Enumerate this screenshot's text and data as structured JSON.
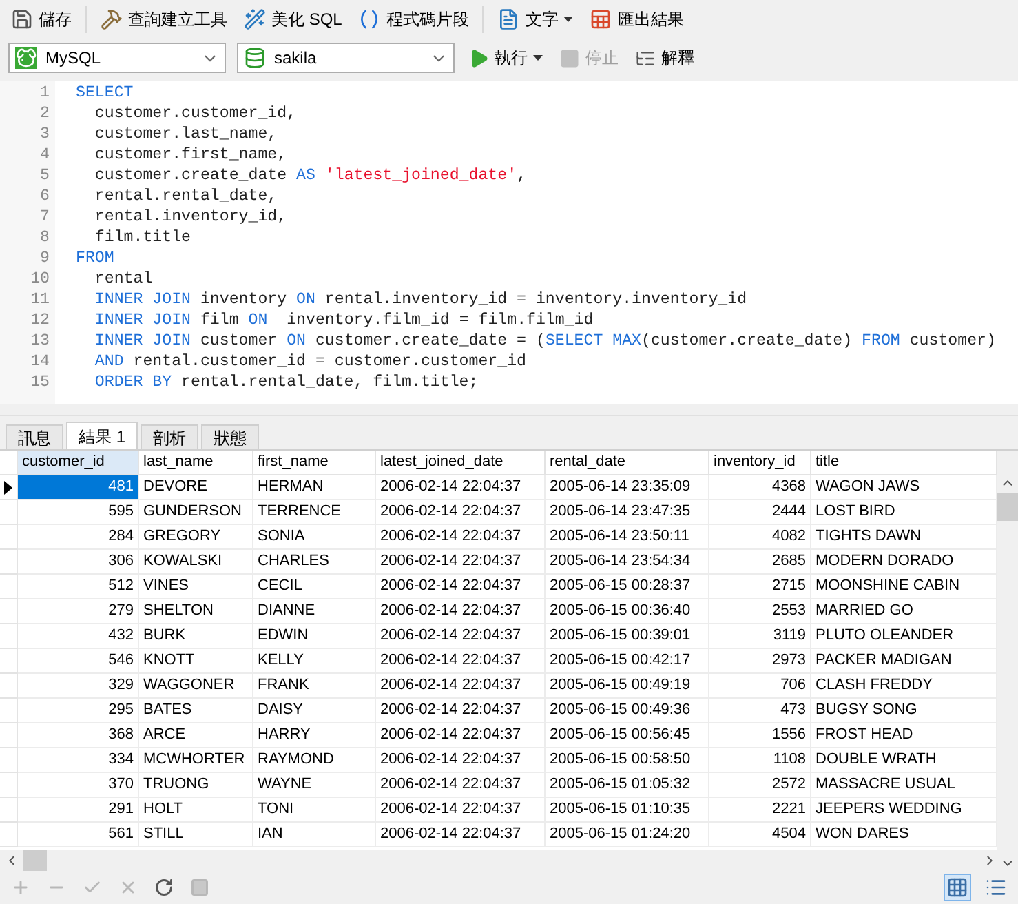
{
  "toolbar": [
    {
      "kind": "save",
      "label": "儲存"
    },
    {
      "kind": "builder",
      "label": "查詢建立工具"
    },
    {
      "kind": "beautify",
      "label": "美化 SQL"
    },
    {
      "kind": "snippet",
      "label": "程式碼片段"
    },
    {
      "kind": "text",
      "label": "文字",
      "dropdown": true
    },
    {
      "kind": "export",
      "label": "匯出結果"
    }
  ],
  "connection": {
    "value": "MySQL"
  },
  "database": {
    "value": "sakila"
  },
  "actions": [
    {
      "kind": "run",
      "label": "執行",
      "dropdown": true,
      "disabled": false
    },
    {
      "kind": "stop",
      "label": "停止",
      "disabled": true
    },
    {
      "kind": "explain",
      "label": "解釋",
      "disabled": false
    }
  ],
  "editor": {
    "lines": [
      {
        "number": "1",
        "tokens": [
          {
            "kind": "kw",
            "text": "SELECT"
          }
        ]
      },
      {
        "number": "2",
        "tokens": [
          {
            "kind": "plain",
            "text": "  customer.customer_id,"
          }
        ]
      },
      {
        "number": "3",
        "tokens": [
          {
            "kind": "plain",
            "text": "  customer.last_name,"
          }
        ]
      },
      {
        "number": "4",
        "tokens": [
          {
            "kind": "plain",
            "text": "  customer.first_name,"
          }
        ]
      },
      {
        "number": "5",
        "tokens": [
          {
            "kind": "plain",
            "text": "  customer.create_date "
          },
          {
            "kind": "kw",
            "text": "AS "
          },
          {
            "kind": "str",
            "text": "'latest_joined_date'"
          },
          {
            "kind": "plain",
            "text": ","
          }
        ]
      },
      {
        "number": "6",
        "tokens": [
          {
            "kind": "plain",
            "text": "  rental.rental_date,"
          }
        ]
      },
      {
        "number": "7",
        "tokens": [
          {
            "kind": "plain",
            "text": "  rental.inventory_id,"
          }
        ]
      },
      {
        "number": "8",
        "tokens": [
          {
            "kind": "plain",
            "text": "  film.title"
          }
        ]
      },
      {
        "number": "9",
        "tokens": [
          {
            "kind": "kw",
            "text": "FROM"
          }
        ]
      },
      {
        "number": "10",
        "tokens": [
          {
            "kind": "plain",
            "text": "  rental"
          }
        ]
      },
      {
        "number": "11",
        "tokens": [
          {
            "kind": "kw",
            "text": "  INNER JOIN"
          },
          {
            "kind": "plain",
            "text": " inventory "
          },
          {
            "kind": "kw",
            "text": "ON"
          },
          {
            "kind": "plain",
            "text": " rental.inventory_id = inventory.inventory_id"
          }
        ]
      },
      {
        "number": "12",
        "tokens": [
          {
            "kind": "kw",
            "text": "  INNER JOIN"
          },
          {
            "kind": "plain",
            "text": " film "
          },
          {
            "kind": "kw",
            "text": "ON"
          },
          {
            "kind": "plain",
            "text": "  inventory.film_id = film.film_id"
          }
        ]
      },
      {
        "number": "13",
        "tokens": [
          {
            "kind": "kw",
            "text": "  INNER JOIN"
          },
          {
            "kind": "plain",
            "text": " customer "
          },
          {
            "kind": "kw",
            "text": "ON"
          },
          {
            "kind": "plain",
            "text": " customer.create_date = ("
          },
          {
            "kind": "kw",
            "text": "SELECT MAX"
          },
          {
            "kind": "plain",
            "text": "(customer.create_date) "
          },
          {
            "kind": "kw",
            "text": "FROM"
          },
          {
            "kind": "plain",
            "text": " customer)"
          }
        ]
      },
      {
        "number": "14",
        "tokens": [
          {
            "kind": "kw",
            "text": "  AND"
          },
          {
            "kind": "plain",
            "text": " rental.customer_id = customer.customer_id"
          }
        ]
      },
      {
        "number": "15",
        "tokens": [
          {
            "kind": "kw",
            "text": "  ORDER BY"
          },
          {
            "kind": "plain",
            "text": " rental.rental_date, film.title;"
          }
        ]
      }
    ]
  },
  "result_tabs": [
    {
      "label": "訊息",
      "selected": false
    },
    {
      "label": "結果 1",
      "selected": true
    },
    {
      "label": "剖析",
      "selected": false
    },
    {
      "label": "狀態",
      "selected": false
    }
  ],
  "table": {
    "columns": [
      {
        "label": "customer_id",
        "kind": "number",
        "selected": true
      },
      {
        "label": "last_name",
        "kind": "text",
        "selected": false
      },
      {
        "label": "first_name",
        "kind": "text",
        "selected": false
      },
      {
        "label": "latest_joined_date",
        "kind": "text",
        "selected": false
      },
      {
        "label": "rental_date",
        "kind": "text",
        "selected": false
      },
      {
        "label": "inventory_id",
        "kind": "number",
        "selected": false
      },
      {
        "label": "title",
        "kind": "text",
        "selected": false
      }
    ],
    "rows": [
      {
        "selected": true,
        "cells": [
          "481",
          "DEVORE",
          "HERMAN",
          "2006-02-14 22:04:37",
          "2005-06-14 23:35:09",
          "4368",
          "WAGON JAWS"
        ]
      },
      {
        "selected": false,
        "cells": [
          "595",
          "GUNDERSON",
          "TERRENCE",
          "2006-02-14 22:04:37",
          "2005-06-14 23:47:35",
          "2444",
          "LOST BIRD"
        ]
      },
      {
        "selected": false,
        "cells": [
          "284",
          "GREGORY",
          "SONIA",
          "2006-02-14 22:04:37",
          "2005-06-14 23:50:11",
          "4082",
          "TIGHTS DAWN"
        ]
      },
      {
        "selected": false,
        "cells": [
          "306",
          "KOWALSKI",
          "CHARLES",
          "2006-02-14 22:04:37",
          "2005-06-14 23:54:34",
          "2685",
          "MODERN DORADO"
        ]
      },
      {
        "selected": false,
        "cells": [
          "512",
          "VINES",
          "CECIL",
          "2006-02-14 22:04:37",
          "2005-06-15 00:28:37",
          "2715",
          "MOONSHINE CABIN"
        ]
      },
      {
        "selected": false,
        "cells": [
          "279",
          "SHELTON",
          "DIANNE",
          "2006-02-14 22:04:37",
          "2005-06-15 00:36:40",
          "2553",
          "MARRIED GO"
        ]
      },
      {
        "selected": false,
        "cells": [
          "432",
          "BURK",
          "EDWIN",
          "2006-02-14 22:04:37",
          "2005-06-15 00:39:01",
          "3119",
          "PLUTO OLEANDER"
        ]
      },
      {
        "selected": false,
        "cells": [
          "546",
          "KNOTT",
          "KELLY",
          "2006-02-14 22:04:37",
          "2005-06-15 00:42:17",
          "2973",
          "PACKER MADIGAN"
        ]
      },
      {
        "selected": false,
        "cells": [
          "329",
          "WAGGONER",
          "FRANK",
          "2006-02-14 22:04:37",
          "2005-06-15 00:49:19",
          "706",
          "CLASH FREDDY"
        ]
      },
      {
        "selected": false,
        "cells": [
          "295",
          "BATES",
          "DAISY",
          "2006-02-14 22:04:37",
          "2005-06-15 00:49:36",
          "473",
          "BUGSY SONG"
        ]
      },
      {
        "selected": false,
        "cells": [
          "368",
          "ARCE",
          "HARRY",
          "2006-02-14 22:04:37",
          "2005-06-15 00:56:45",
          "1556",
          "FROST HEAD"
        ]
      },
      {
        "selected": false,
        "cells": [
          "334",
          "MCWHORTER",
          "RAYMOND",
          "2006-02-14 22:04:37",
          "2005-06-15 00:58:50",
          "1108",
          "DOUBLE WRATH"
        ]
      },
      {
        "selected": false,
        "cells": [
          "370",
          "TRUONG",
          "WAYNE",
          "2006-02-14 22:04:37",
          "2005-06-15 01:05:32",
          "2572",
          "MASSACRE USUAL"
        ]
      },
      {
        "selected": false,
        "cells": [
          "291",
          "HOLT",
          "TONI",
          "2006-02-14 22:04:37",
          "2005-06-15 01:10:35",
          "2221",
          "JEEPERS WEDDING"
        ]
      },
      {
        "selected": false,
        "cells": [
          "561",
          "STILL",
          "IAN",
          "2006-02-14 22:04:37",
          "2005-06-15 01:24:20",
          "4504",
          "WON DARES"
        ]
      }
    ]
  },
  "record_tools": [
    {
      "kind": "add",
      "disabled": true
    },
    {
      "kind": "remove",
      "disabled": true
    },
    {
      "kind": "apply",
      "disabled": true
    },
    {
      "kind": "discard",
      "disabled": true
    },
    {
      "kind": "refresh",
      "disabled": false
    },
    {
      "kind": "stop",
      "disabled": true
    }
  ],
  "views": [
    {
      "kind": "grid",
      "selected": true
    },
    {
      "kind": "form",
      "selected": false
    }
  ]
}
